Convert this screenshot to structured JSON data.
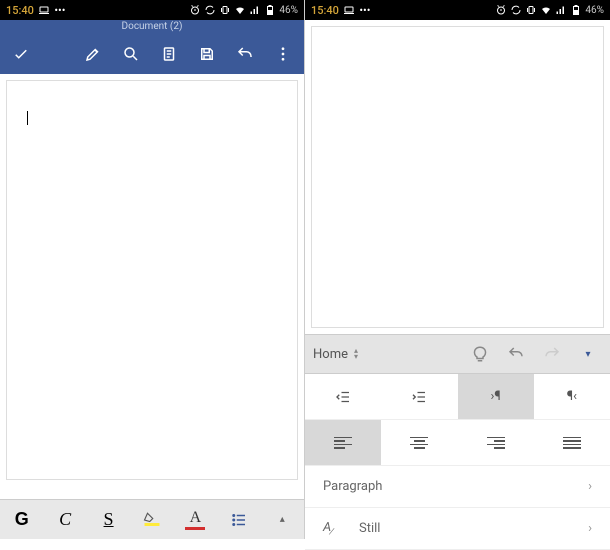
{
  "status": {
    "time": "15:40",
    "battery": "46%"
  },
  "left": {
    "title": "Document (2)",
    "bottom": {
      "bold": "G",
      "italic": "C",
      "underline": "S",
      "fontcolor": "A"
    }
  },
  "right": {
    "ribbon": {
      "tab": "Home"
    },
    "menu": {
      "paragraph": "Paragraph",
      "still": "Still"
    },
    "para_marker": "¶"
  }
}
